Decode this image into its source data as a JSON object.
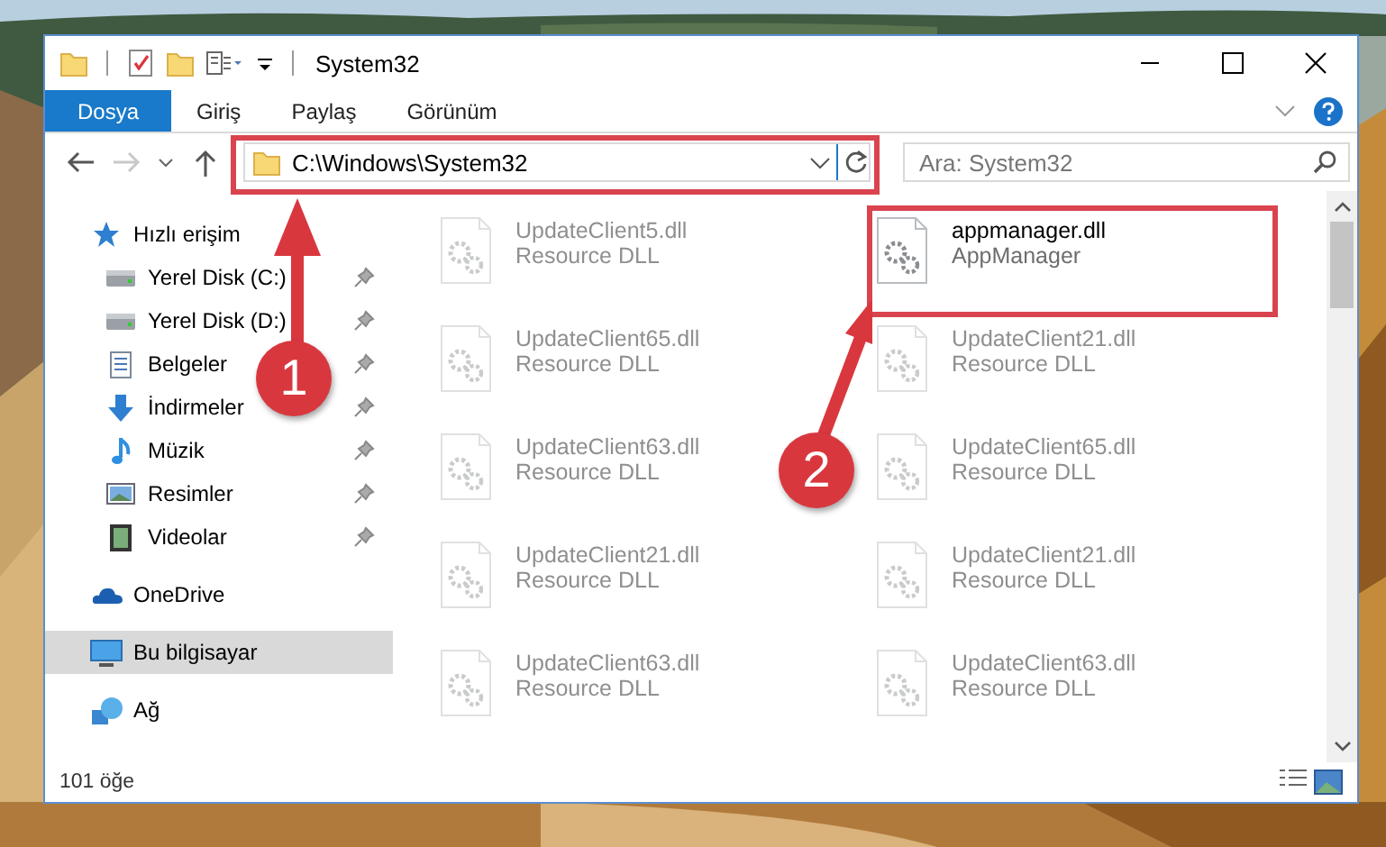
{
  "window": {
    "title": "System32"
  },
  "tabs": [
    {
      "label": "Dosya",
      "selected": true
    },
    {
      "label": "Giriş",
      "selected": false
    },
    {
      "label": "Paylaş",
      "selected": false
    },
    {
      "label": "Görünüm",
      "selected": false
    }
  ],
  "address": {
    "value": "C:\\Windows\\System32"
  },
  "search": {
    "placeholder": "Ara: System32"
  },
  "sidebar": {
    "items": [
      {
        "label": "Hızlı erişim",
        "kind": "star",
        "selected": false,
        "children": [
          {
            "label": "Yerel Disk (C:)",
            "kind": "drive",
            "pinned": true,
            "selected": false
          },
          {
            "label": "Yerel Disk (D:)",
            "kind": "drive",
            "pinned": true,
            "selected": false
          },
          {
            "label": "Belgeler",
            "kind": "doc",
            "pinned": true,
            "selected": false
          },
          {
            "label": "İndirmeler",
            "kind": "download",
            "pinned": true,
            "selected": false
          },
          {
            "label": "Müzik",
            "kind": "music",
            "pinned": true,
            "selected": false
          },
          {
            "label": "Resimler",
            "kind": "pictures",
            "pinned": true,
            "selected": false
          },
          {
            "label": "Videolar",
            "kind": "video",
            "pinned": true,
            "selected": false
          }
        ]
      },
      {
        "label": "OneDrive",
        "kind": "cloud",
        "selected": false
      },
      {
        "label": "Bu bilgisayar",
        "kind": "pc",
        "selected": true
      },
      {
        "label": "Ağ",
        "kind": "network",
        "selected": false
      }
    ]
  },
  "files": [
    {
      "name": "UpdateClient5.dll",
      "type": "Resource DLL",
      "dimmed": true
    },
    {
      "name": "appmanager.dll",
      "type": "AppManager",
      "dimmed": false
    },
    {
      "name": "UpdateClient65.dll",
      "type": "Resource DLL",
      "dimmed": true
    },
    {
      "name": "UpdateClient21.dll",
      "type": "Resource DLL",
      "dimmed": true
    },
    {
      "name": "UpdateClient63.dll",
      "type": "Resource DLL",
      "dimmed": true
    },
    {
      "name": "UpdateClient65.dll",
      "type": "Resource DLL",
      "dimmed": true
    },
    {
      "name": "UpdateClient21.dll",
      "type": "Resource DLL",
      "dimmed": true
    },
    {
      "name": "UpdateClient21.dll",
      "type": "Resource DLL",
      "dimmed": true
    },
    {
      "name": "UpdateClient63.dll",
      "type": "Resource DLL",
      "dimmed": true
    },
    {
      "name": "UpdateClient63.dll",
      "type": "Resource DLL",
      "dimmed": true
    }
  ],
  "status_bar": {
    "count": "101 öğe"
  },
  "annotations": [
    {
      "label": "1"
    },
    {
      "label": "2"
    }
  ]
}
